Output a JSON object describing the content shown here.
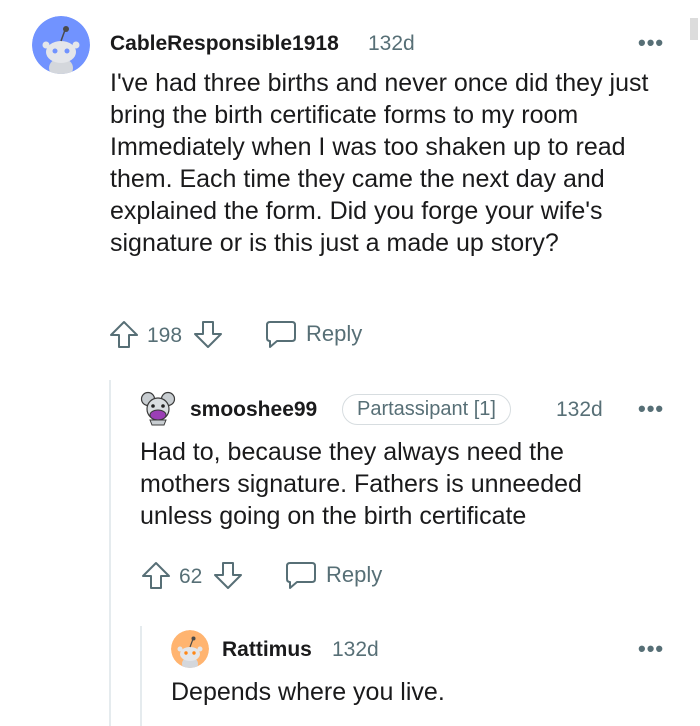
{
  "comments": [
    {
      "author": "CableResponsible1918",
      "age": "132d",
      "avatar_color": "#7193ff",
      "body": "I've had three births and never once did they just bring the birth certificate forms to my room Immediately when I was too shaken up to read them. Each time they came the next day and explained the form. Did you forge your wife's signature or is this just a made up story?",
      "votes": "198",
      "reply_label": "Reply"
    },
    {
      "author": "smooshee99",
      "flair": "Partassipant [1]",
      "age": "132d",
      "body": "Had to, because they always need the mothers signature. Fathers is unneeded unless going on the birth certificate",
      "votes": "62",
      "reply_label": "Reply"
    },
    {
      "author": "Rattimus",
      "age": "132d",
      "avatar_color": "#ffb470",
      "body": "Depends where you live."
    }
  ],
  "more_label": "•••"
}
